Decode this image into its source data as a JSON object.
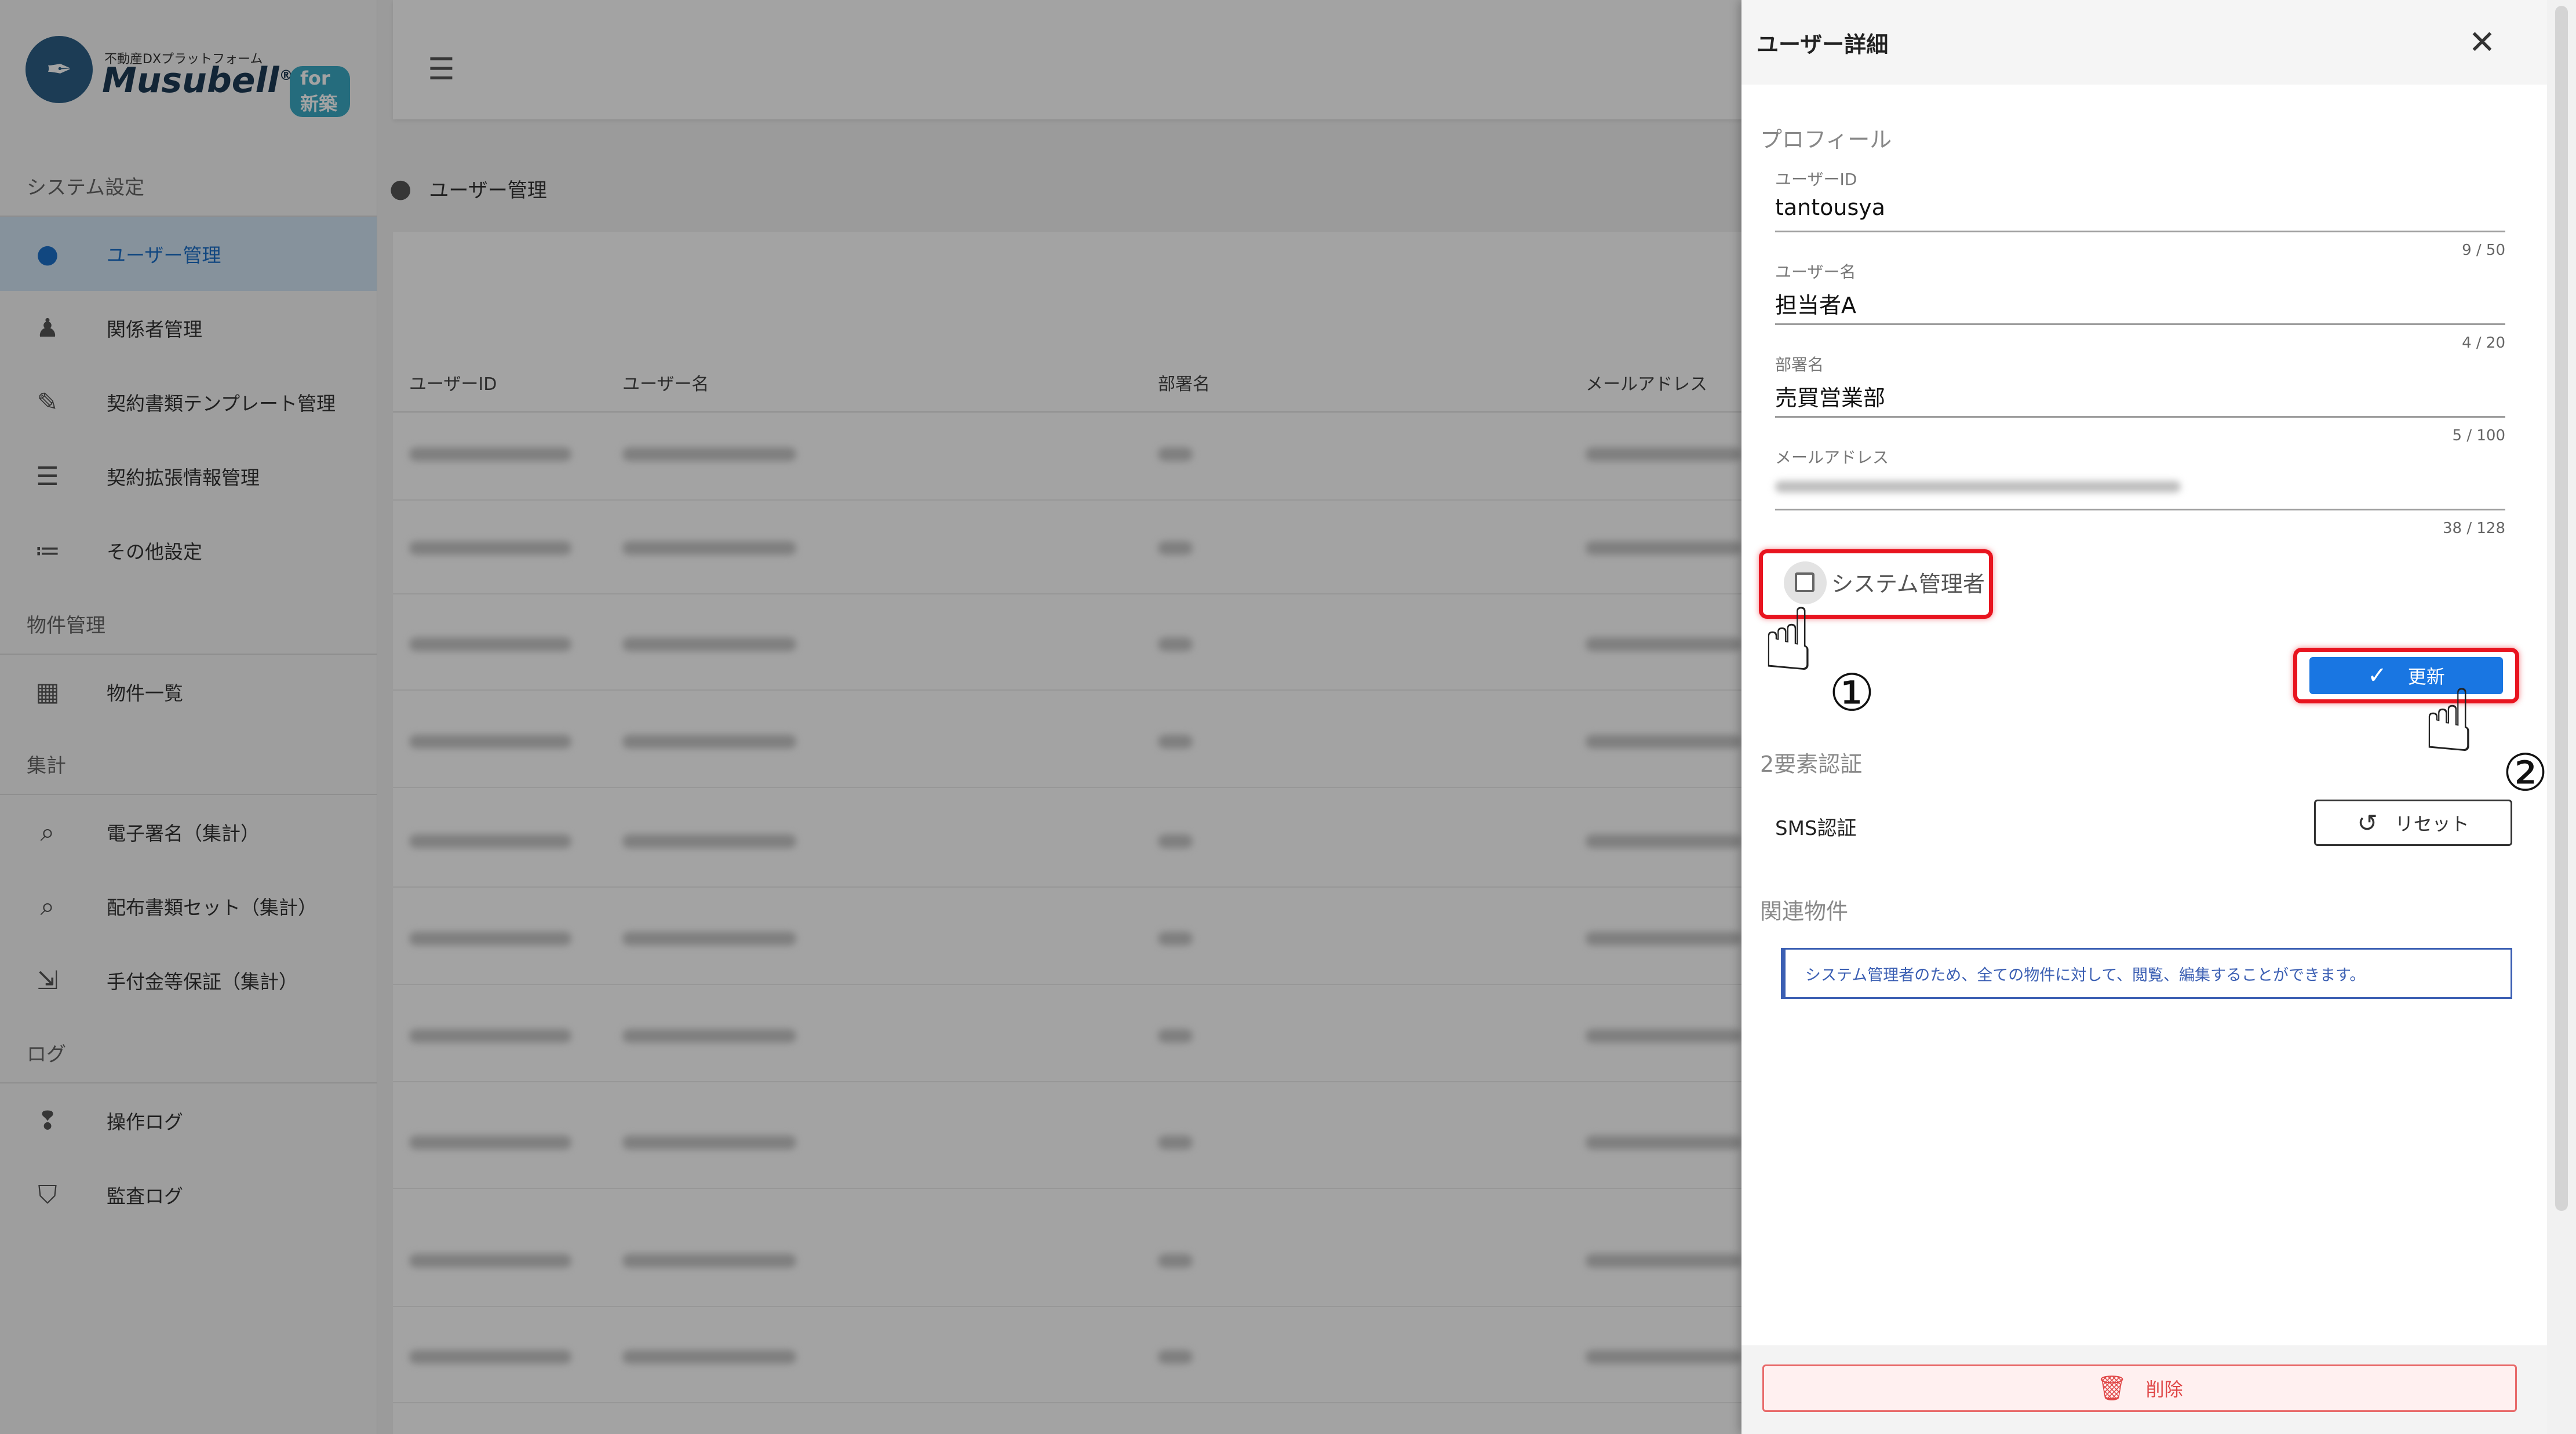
{
  "logo": {
    "small": "不動産DXプラットフォーム",
    "name": "Musubell",
    "registered": "®",
    "badge": "for 新築"
  },
  "sidebar": {
    "sections": [
      {
        "title": "システム設定"
      },
      {
        "title": "物件管理"
      },
      {
        "title": "集計"
      },
      {
        "title": "ログ"
      }
    ],
    "items": [
      {
        "label": "ユーザー管理",
        "icon": "person-icon"
      },
      {
        "label": "関係者管理",
        "icon": "people-icon"
      },
      {
        "label": "契約書類テンプレート管理",
        "icon": "edit-document-icon"
      },
      {
        "label": "契約拡張情報管理",
        "icon": "list-document-icon"
      },
      {
        "label": "その他設定",
        "icon": "list-icon"
      },
      {
        "label": "物件一覧",
        "icon": "building-icon"
      },
      {
        "label": "電子署名（集計）",
        "icon": "search-document-icon"
      },
      {
        "label": "配布書類セット（集計）",
        "icon": "search-document-icon"
      },
      {
        "label": "手付金等保証（集計）",
        "icon": "export-document-icon"
      },
      {
        "label": "操作ログ",
        "icon": "footsteps-icon"
      },
      {
        "label": "監査ログ",
        "icon": "shield-search-icon"
      }
    ],
    "active_index": 0
  },
  "page": {
    "crumb": "ユーザー管理",
    "columns": [
      "ユーザーID",
      "ユーザー名",
      "部署名",
      "メールアドレス"
    ]
  },
  "drawer": {
    "title": "ユーザー詳細",
    "close_icon": "close-icon",
    "profile_title": "プロフィール",
    "fields": [
      {
        "label": "ユーザーID",
        "value": "tantousya",
        "counter": "9 / 50"
      },
      {
        "label": "ユーザー名",
        "value": "担当者A",
        "counter": "4 / 20"
      },
      {
        "label": "部署名",
        "value": "売買営業部",
        "counter": "5 / 100"
      },
      {
        "label": "メールアドレス",
        "value": "",
        "counter": "38 / 128"
      }
    ],
    "admin_checkbox_label": "システム管理者",
    "admin_checked": false,
    "update_label": "更新",
    "twofa_title": "2要素認証",
    "sms_label": "SMS認証",
    "reset_label": "リセット",
    "related_title": "関連物件",
    "info_text": "システム管理者のため、全ての物件に対して、閲覧、編集することができます。",
    "delete_label": "削除"
  },
  "annotations": {
    "step1": "①",
    "step2": "②"
  },
  "colors": {
    "primary": "#1976e2",
    "highlight": "#e8141f",
    "active_nav_bg": "#d2e4f5",
    "info": "#3b5fb3",
    "danger": "#e04848"
  }
}
